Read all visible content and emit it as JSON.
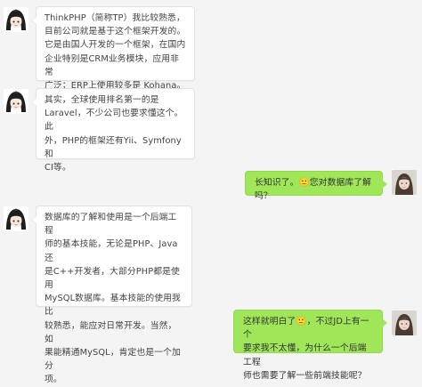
{
  "colors": {
    "background": "#f4f4f4",
    "incoming_bubble": "#ffffff",
    "outgoing_bubble": "#9fe658",
    "text": "#444444"
  },
  "messages": [
    {
      "side": "incoming",
      "avatar": "anime-girl-avatar-icon",
      "text": "ThinkPHP（简称TP）我比较熟悉，\n目前公司就是基于这个框架开发的。\n它是由国人开发的一个框架，在国内\n企业特别是CRM业务模块，应用非常\n广泛；ERP上使用较多是 Kohana。"
    },
    {
      "side": "incoming",
      "avatar": "anime-girl-avatar-icon",
      "text": "其实，全球使用排名第一的是\nLaravel，不少公司也要求懂这个。此\n外，PHP的框架还有Yii、Symfony和\nCI等。"
    },
    {
      "side": "outgoing",
      "avatar": "user-photo-avatar-icon",
      "text": "长知识了。🙂您对数据库了解吗？"
    },
    {
      "side": "incoming",
      "avatar": "anime-girl-avatar-icon",
      "text": "数据库的了解和使用是一个后端工程\n师的基本技能，无论是PHP、Java还\n是C++开发者，大部分PHP都是使用\nMySQL数据库。基本技能的使用我比\n较熟悉，能应对日常开发。当然，如\n果能精通MySQL，肯定也是一个加分\n项。"
    },
    {
      "side": "outgoing",
      "avatar": "user-photo-avatar-icon",
      "text": "这样就明白了🙂，不过JD上有一个\n要求我不太懂，为什么一个后端工程\n师也需要了解一些前端技能呢？"
    }
  ]
}
